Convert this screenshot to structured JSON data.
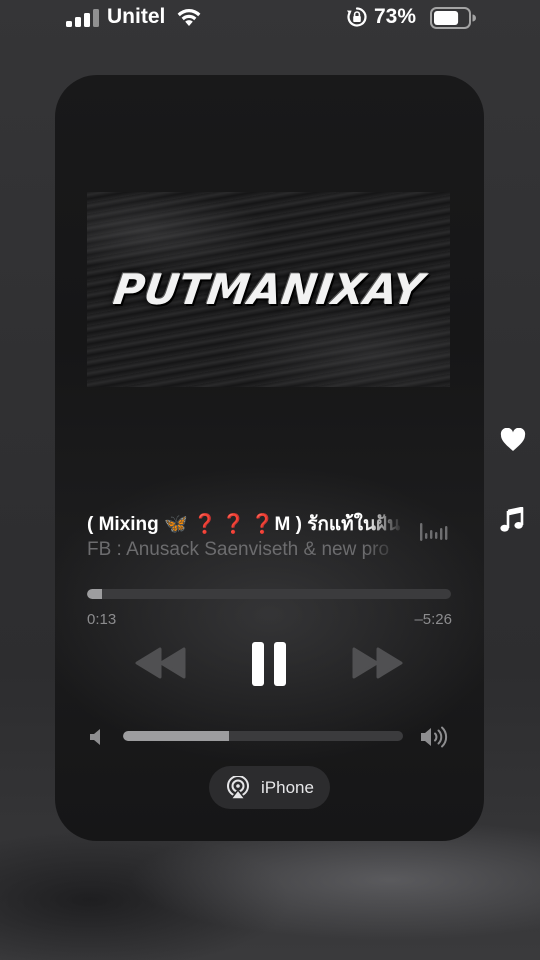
{
  "status_bar": {
    "carrier": "Unitel",
    "battery_percent": "73%",
    "battery_level": 0.73,
    "signal_bars": 3,
    "signal_bars_max": 4,
    "icons": [
      "signal-icon",
      "wifi-icon",
      "rotation-lock-icon",
      "battery-icon"
    ]
  },
  "player": {
    "artwork_text": "PUTMANIXAY",
    "title": "( Mixing 🦋 ❓ ❓ ❓M ) รักแท้ในฝัน",
    "artist": "FB : Anusack Saenviseth & new pro",
    "elapsed": "0:13",
    "remaining": "–5:26",
    "progress": 0.04,
    "volume": 0.38,
    "output_device": "iPhone",
    "controls": [
      "rewind-icon",
      "pause-icon",
      "fast-forward-icon"
    ],
    "colors": {
      "card_background": "#171718",
      "track": "#3b3b3d",
      "fill": "#9d9d9f",
      "secondary_text": "#6c6c6e"
    }
  },
  "side_shortcuts": [
    "heart-icon",
    "music-note-icon"
  ]
}
